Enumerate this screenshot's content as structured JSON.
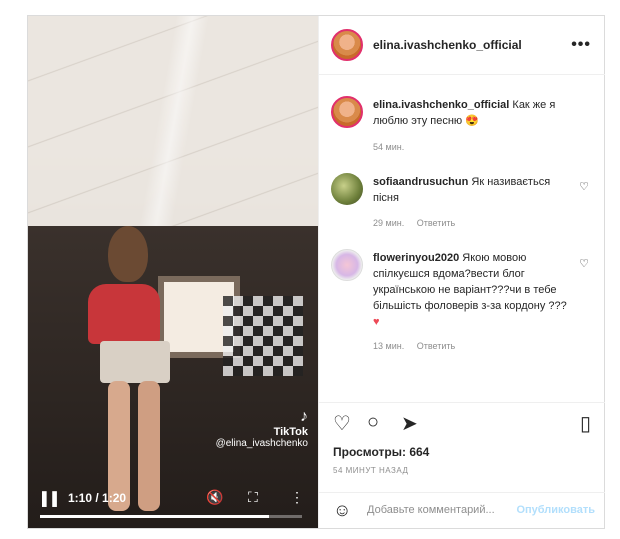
{
  "post": {
    "username": "elina.ivashchenko_official",
    "caption": "Как же я люблю эту песню",
    "caption_time": "54 мин."
  },
  "video": {
    "time": "1:10 / 1:20",
    "progress": 0.875,
    "tiktok_brand": "TikTok",
    "tiktok_handle": "@elina_ivashchenko"
  },
  "comments": [
    {
      "username": "sofiaandrusuchun",
      "text": "Як називається пісня",
      "time": "29 мин.",
      "reply": "Ответить"
    },
    {
      "username": "flowerinyou2020",
      "text": "Якою мовою спілкуєшся вдома?вести блог українською не варіант???чи в тебе більшість фоловерів з-за кордону ???",
      "time": "13 мин.",
      "reply": "Ответить"
    }
  ],
  "stats": {
    "views_label": "Просмотры: 664",
    "time_ago": "54 МИНУТ НАЗАД"
  },
  "add_comment": {
    "placeholder": "Добавьте комментарий...",
    "publish": "Опубликовать"
  },
  "icons": [
    "more-icon",
    "heart-icon",
    "comment-icon",
    "share-icon",
    "bookmark-icon",
    "smile-icon",
    "pause-icon",
    "mute-icon",
    "fullscreen-icon",
    "video-more-icon"
  ]
}
